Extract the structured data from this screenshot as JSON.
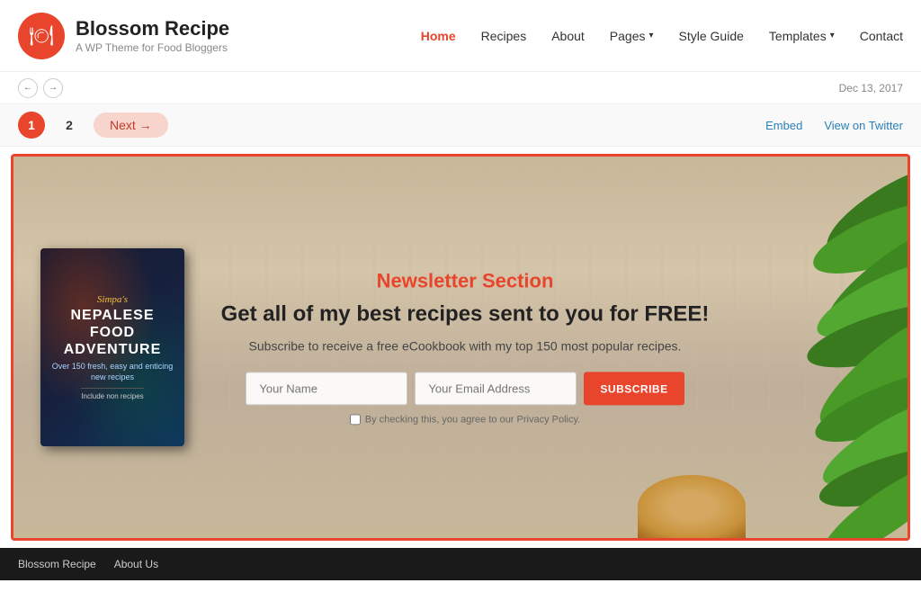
{
  "header": {
    "logo_icon": "🍽",
    "brand_name": "Blossom Recipe",
    "brand_tagline": "A WP Theme for Food Bloggers",
    "nav": {
      "home": "Home",
      "recipes": "Recipes",
      "about": "About",
      "pages": "Pages",
      "style_guide": "Style Guide",
      "templates": "Templates",
      "contact": "Contact"
    }
  },
  "toolbar": {
    "date": "Dec 13, 2017",
    "prev_icon": "←",
    "next_icon": "→"
  },
  "pagination": {
    "page1": "1",
    "page2": "2",
    "next_label": "Next →",
    "embed_label": "Embed",
    "view_on_twitter_label": "View on Twitter"
  },
  "newsletter": {
    "section_label": "Newsletter Section",
    "heading": "Get all of my best recipes sent to you for FREE!",
    "subtext": "Subscribe to receive a free eCookbook with my top 150 most popular recipes.",
    "name_placeholder": "Your Name",
    "email_placeholder": "Your Email Address",
    "subscribe_btn": "SUBSCRIBE",
    "privacy_text": "By checking this, you agree to our Privacy Policy.",
    "book": {
      "cursive_title": "Simpa's",
      "title_line1": "NEPALESE",
      "title_line2": "FOOD",
      "title_line3": "ADVENTURE",
      "subtitle": "Over 150 fresh, easy and enticing new recipes",
      "tagline": "Include non recipes"
    }
  },
  "footer": {
    "brand": "Blossom Recipe",
    "links": "About Us"
  }
}
